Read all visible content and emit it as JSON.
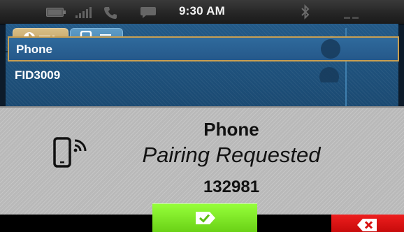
{
  "status_bar": {
    "time": "9:30 AM",
    "icons": [
      "battery-icon",
      "signal-strength-icon",
      "phone-call-icon",
      "message-icon",
      "bluetooth-icon",
      "network-icon"
    ]
  },
  "phone_list": {
    "tabs": [
      {
        "name": "bluetooth-devices-tab",
        "icon": "bluetooth-list-icon",
        "active": true
      },
      {
        "name": "import-contacts-tab",
        "icon": "phone-import-icon",
        "active": false
      }
    ],
    "header_icon": "phone-handset-icon",
    "rows": [
      {
        "label": "Phone",
        "selected": true
      },
      {
        "label": "FID3009",
        "selected": false
      }
    ]
  },
  "dialog": {
    "icon": "wireless-phone-icon",
    "title": "Phone",
    "message": "Pairing Requested",
    "code": "132981"
  },
  "actions": {
    "accept": {
      "icon": "checkmark-tag-icon",
      "color": "#7ee524"
    },
    "reject": {
      "icon": "delete-x-icon",
      "color": "#e01414"
    }
  }
}
